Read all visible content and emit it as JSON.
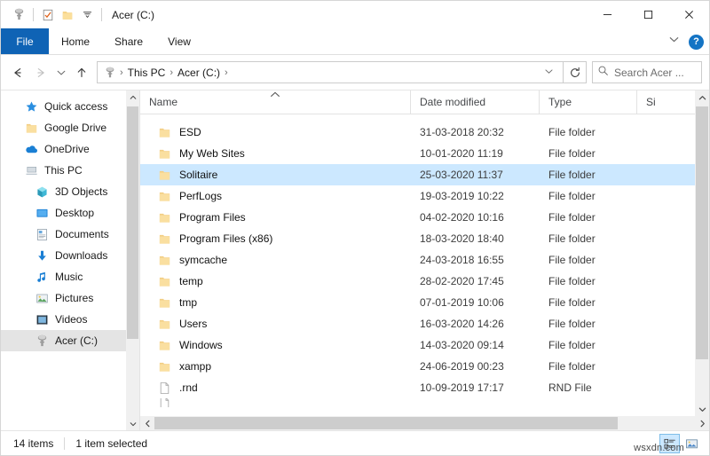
{
  "titlebar": {
    "title": "Acer (C:)",
    "qat": [
      {
        "name": "drive-icon",
        "label": "Acer (C:) quick access"
      },
      {
        "name": "properties-icon",
        "label": "Properties"
      },
      {
        "name": "new-folder-icon",
        "label": "New folder"
      },
      {
        "name": "customize-dropdown-icon",
        "label": "Customize Quick Access Toolbar"
      }
    ],
    "minimize_label": "Minimize",
    "maximize_label": "Maximize",
    "close_label": "Close"
  },
  "ribbon": {
    "tabs": [
      {
        "label": "File",
        "active": true
      },
      {
        "label": "Home",
        "active": false
      },
      {
        "label": "Share",
        "active": false
      },
      {
        "label": "View",
        "active": false
      }
    ],
    "expand_label": "Expand the Ribbon",
    "help_label": "?"
  },
  "addressbar": {
    "back_label": "Back",
    "forward_label": "Forward",
    "recent_label": "Recent locations",
    "up_label": "Up",
    "breadcrumbs": [
      "This PC",
      "Acer (C:)"
    ],
    "separator": "›",
    "refresh_label": "Refresh",
    "search_placeholder": "Search Acer ..."
  },
  "sidebar": {
    "items": [
      {
        "label": "Quick access",
        "icon": "star-icon",
        "indent": false,
        "selected": false
      },
      {
        "label": "Google Drive",
        "icon": "folder-icon",
        "indent": false,
        "selected": false
      },
      {
        "label": "OneDrive",
        "icon": "cloud-icon",
        "indent": false,
        "selected": false
      },
      {
        "label": "This PC",
        "icon": "pc-icon",
        "indent": false,
        "selected": false
      },
      {
        "label": "3D Objects",
        "icon": "cube-icon",
        "indent": true,
        "selected": false
      },
      {
        "label": "Desktop",
        "icon": "desktop-icon",
        "indent": true,
        "selected": false
      },
      {
        "label": "Documents",
        "icon": "documents-icon",
        "indent": true,
        "selected": false
      },
      {
        "label": "Downloads",
        "icon": "download-icon",
        "indent": true,
        "selected": false
      },
      {
        "label": "Music",
        "icon": "music-icon",
        "indent": true,
        "selected": false
      },
      {
        "label": "Pictures",
        "icon": "pictures-icon",
        "indent": true,
        "selected": false
      },
      {
        "label": "Videos",
        "icon": "videos-icon",
        "indent": true,
        "selected": false
      },
      {
        "label": "Acer (C:)",
        "icon": "drive-icon",
        "indent": true,
        "selected": true
      }
    ]
  },
  "filelist": {
    "columns": [
      {
        "label": "Name",
        "sorted": "asc"
      },
      {
        "label": "Date modified",
        "sorted": ""
      },
      {
        "label": "Type",
        "sorted": ""
      },
      {
        "label": "Si",
        "sorted": ""
      }
    ],
    "rows": [
      {
        "name": "ESD",
        "date": "31-03-2018 20:32",
        "type": "File folder",
        "icon": "folder-icon",
        "selected": false
      },
      {
        "name": "My Web Sites",
        "date": "10-01-2020 11:19",
        "type": "File folder",
        "icon": "folder-icon",
        "selected": false
      },
      {
        "name": "Solitaire",
        "date": "25-03-2020 11:37",
        "type": "File folder",
        "icon": "folder-icon",
        "selected": true
      },
      {
        "name": "PerfLogs",
        "date": "19-03-2019 10:22",
        "type": "File folder",
        "icon": "folder-icon",
        "selected": false
      },
      {
        "name": "Program Files",
        "date": "04-02-2020 10:16",
        "type": "File folder",
        "icon": "folder-icon",
        "selected": false
      },
      {
        "name": "Program Files (x86)",
        "date": "18-03-2020 18:40",
        "type": "File folder",
        "icon": "folder-icon",
        "selected": false
      },
      {
        "name": "symcache",
        "date": "24-03-2018 16:55",
        "type": "File folder",
        "icon": "folder-icon",
        "selected": false
      },
      {
        "name": "temp",
        "date": "28-02-2020 17:45",
        "type": "File folder",
        "icon": "folder-icon",
        "selected": false
      },
      {
        "name": "tmp",
        "date": "07-01-2019 10:06",
        "type": "File folder",
        "icon": "folder-icon",
        "selected": false
      },
      {
        "name": "Users",
        "date": "16-03-2020 14:26",
        "type": "File folder",
        "icon": "folder-icon",
        "selected": false
      },
      {
        "name": "Windows",
        "date": "14-03-2020 09:14",
        "type": "File folder",
        "icon": "folder-icon",
        "selected": false
      },
      {
        "name": "xampp",
        "date": "24-06-2019 00:23",
        "type": "File folder",
        "icon": "folder-icon",
        "selected": false
      },
      {
        "name": ".rnd",
        "date": "10-09-2019 17:17",
        "type": "RND File",
        "icon": "file-icon",
        "selected": false
      },
      {
        "name": "",
        "date": "",
        "type": "",
        "icon": "file-icon",
        "selected": false
      }
    ]
  },
  "statusbar": {
    "item_count": "14 items",
    "selection": "1 item selected",
    "details_view_label": "Details view",
    "large_icons_view_label": "Large icons view",
    "watermark": "wsxdn.com"
  },
  "colors": {
    "accent": "#0f63b5",
    "selection": "#cce8ff",
    "folder": "#f7d58b",
    "help_blue": "#1474c4"
  }
}
